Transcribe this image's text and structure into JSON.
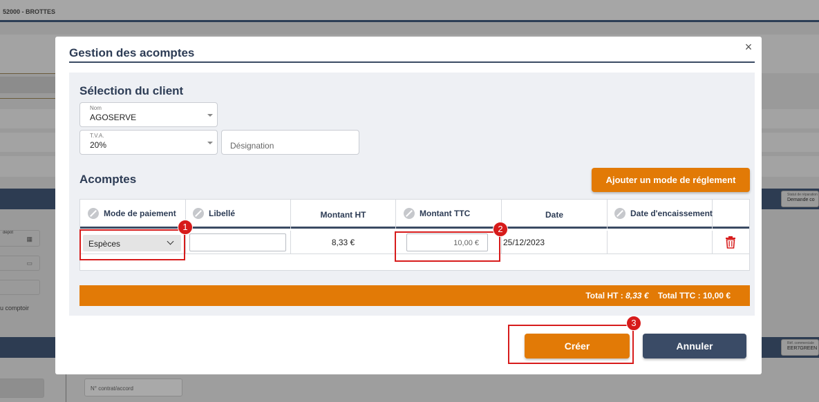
{
  "background": {
    "header_text": "52000 - BROTTES",
    "left_labels": [
      "dépôt",
      "u comptoir"
    ],
    "right_boxes": [
      {
        "label": "Statut de réparation",
        "value": "Demande co"
      },
      {
        "label": "Réf. commerciale",
        "value": "EER7GREEN"
      }
    ],
    "contract_placeholder": "N° contrat/accord"
  },
  "modal": {
    "title": "Gestion des acomptes",
    "close_label": "×",
    "client_section": {
      "title": "Sélection du client",
      "nom_label": "Nom",
      "nom_value": "AGOSERVE",
      "tva_label": "T.V.A.",
      "tva_value": "20%",
      "designation_placeholder": "Désignation"
    },
    "acomptes_section": {
      "title": "Acomptes",
      "add_button": "Ajouter un mode de réglement",
      "columns": [
        "Mode de paiement",
        "Libellé",
        "Montant HT",
        "Montant TTC",
        "Date",
        "Date d'encaissement"
      ],
      "row": {
        "mode_paiement": "Espèces",
        "libelle": "",
        "montant_ht": "8,33 €",
        "montant_ttc": "10,00 €",
        "date": "25/12/2023",
        "date_encaissement": ""
      },
      "totals": {
        "ht_label": "Total HT :",
        "ht_value": "8,33 €",
        "ttc_label": "Total TTC :",
        "ttc_value": "10,00 €"
      }
    },
    "buttons": {
      "create": "Créer",
      "cancel": "Annuler"
    },
    "badges": [
      "1",
      "2",
      "3"
    ]
  },
  "colors": {
    "accent_orange": "#e27a06",
    "navy": "#3a4b66",
    "highlight_red": "#d71b1b"
  }
}
